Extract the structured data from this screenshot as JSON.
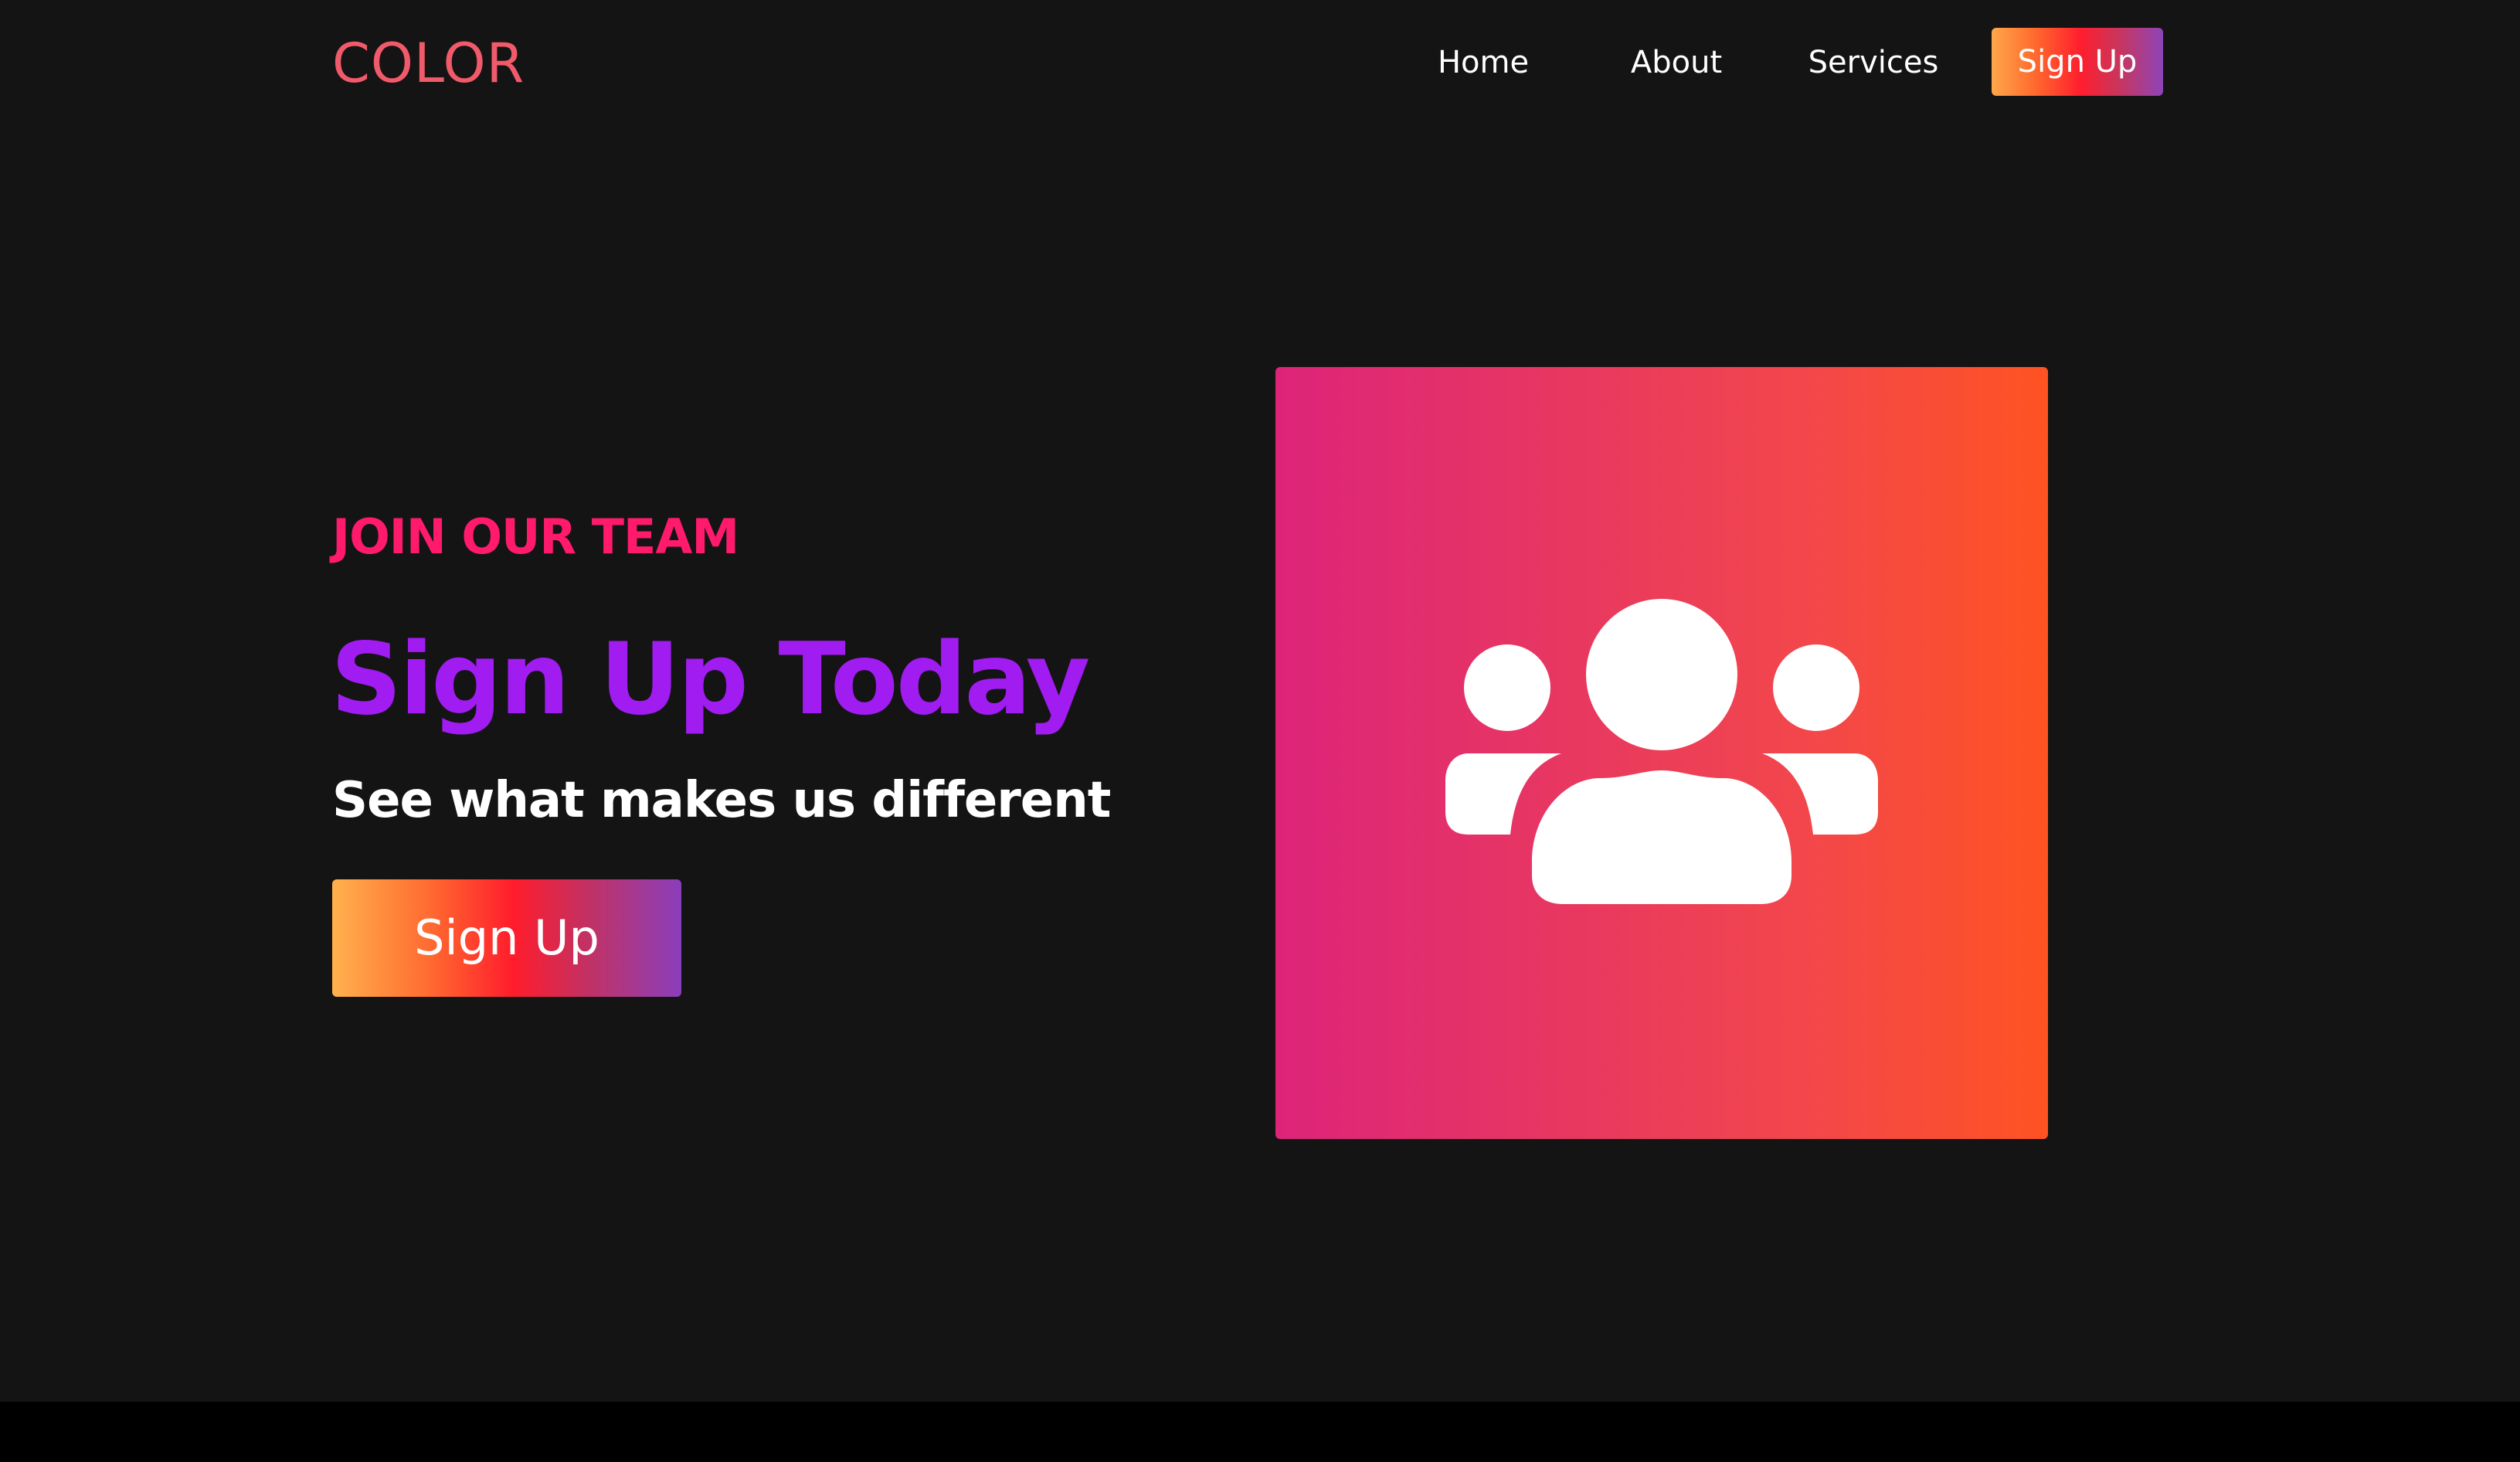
{
  "nav": {
    "logo": "COLOR",
    "links": [
      "Home",
      "About",
      "Services"
    ],
    "signup_label": "Sign Up"
  },
  "hero": {
    "eyebrow": "JOIN OUR TEAM",
    "headline": "Sign Up Today",
    "subhead": "See what makes us different",
    "cta_label": "Sign Up"
  },
  "panel": {
    "icon": "users-group-icon"
  },
  "colors": {
    "background": "#141414",
    "logo": "#f05a6a",
    "eyebrow": "#ff1a6c",
    "headline": "#a01cf0",
    "panel_gradient_start": "#dd2479",
    "panel_gradient_end": "#ff5322"
  }
}
